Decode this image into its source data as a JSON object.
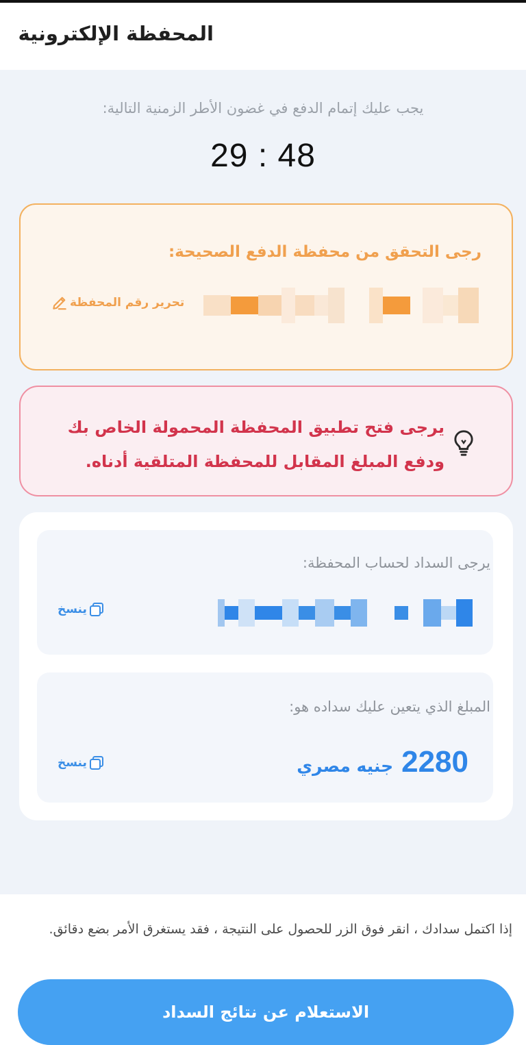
{
  "header": {
    "title": "المحفظة الإلكترونية"
  },
  "payment": {
    "deadline_text": "يجب عليك إتمام الدفع في غضون الأطر الزمنية التالية:",
    "timer": "29 : 48"
  },
  "verify": {
    "title": "رجى التحقق من محفظة الدفع الصحيحة:",
    "edit_label": "تحرير رقم المحفظة"
  },
  "alert": {
    "message": "يرجى فتح تطبيق المحفظة المحمولة الخاص بك ودفع المبلغ المقابل للمحفظة المتلقية أدناه."
  },
  "account": {
    "label": "يرجى السداد لحساب المحفظة:",
    "copy_label": "ينسخ"
  },
  "amount": {
    "label": "المبلغ الذي يتعين عليك سداده هو:",
    "value": "2280",
    "currency": "جنيه مصري",
    "copy_label": "ينسخ"
  },
  "footer": {
    "note": "إذا اكتمل سدادك ، انقر فوق الزر للحصول على النتيجة ، فقد يستغرق الأمر بضع دقائق.",
    "button_label": "الاستعلام عن نتائج السداد"
  },
  "colors": {
    "accent_blue": "#45a1f2",
    "warning_orange": "#f0a04e",
    "alert_red": "#d2344c"
  },
  "icons": {
    "edit": "pencil-icon",
    "alert": "lightbulb-icon",
    "copy": "copy-icon"
  }
}
